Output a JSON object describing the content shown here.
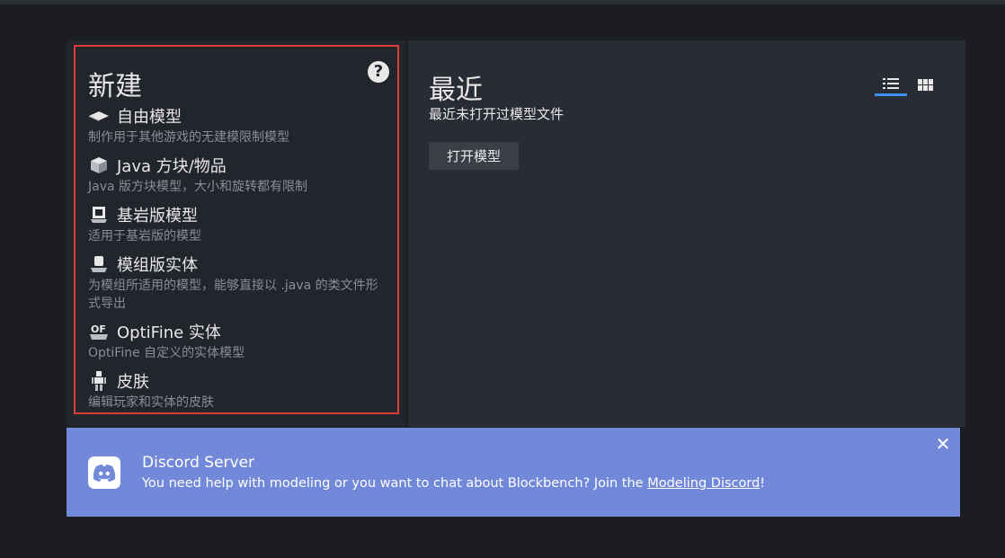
{
  "start_screen": {
    "new_section": {
      "title": "新建",
      "help_icon": "help-circle-icon",
      "items": [
        {
          "icon": "free-model-icon",
          "title": "自由模型",
          "description": "制作用于其他游戏的无建模限制模型"
        },
        {
          "icon": "java-block-icon",
          "title": "Java 方块/物品",
          "description": "Java 版方块模型，大小和旋转都有限制"
        },
        {
          "icon": "bedrock-model-icon",
          "title": "基岩版模型",
          "description": "适用于基岩版的模型"
        },
        {
          "icon": "modded-entity-icon",
          "title": "模组版实体",
          "description": "为模组所适用的模型，能够直接以 .java 的类文件形式导出"
        },
        {
          "icon": "optifine-entity-icon",
          "title": "OptiFine 实体",
          "description": "OptiFine 自定义的实体模型"
        },
        {
          "icon": "skin-icon",
          "title": "皮肤",
          "description": "编辑玩家和实体的皮肤"
        }
      ]
    },
    "recent_section": {
      "title": "最近",
      "empty_text": "最近未打开过模型文件",
      "open_button_label": "打开模型",
      "view_list_icon": "list-view-icon",
      "view_grid_icon": "grid-view-icon",
      "active_view": "list"
    }
  },
  "discord_banner": {
    "icon": "discord-icon",
    "title": "Discord Server",
    "text_before": "You need help with modeling or you want to chat about Blockbench? Join the ",
    "link_text": "Modeling Discord",
    "text_after": "!",
    "close_icon": "close-icon",
    "background_color": "#7289da"
  },
  "colors": {
    "highlight_border": "#e03b3b",
    "accent": "#3e90ff"
  }
}
